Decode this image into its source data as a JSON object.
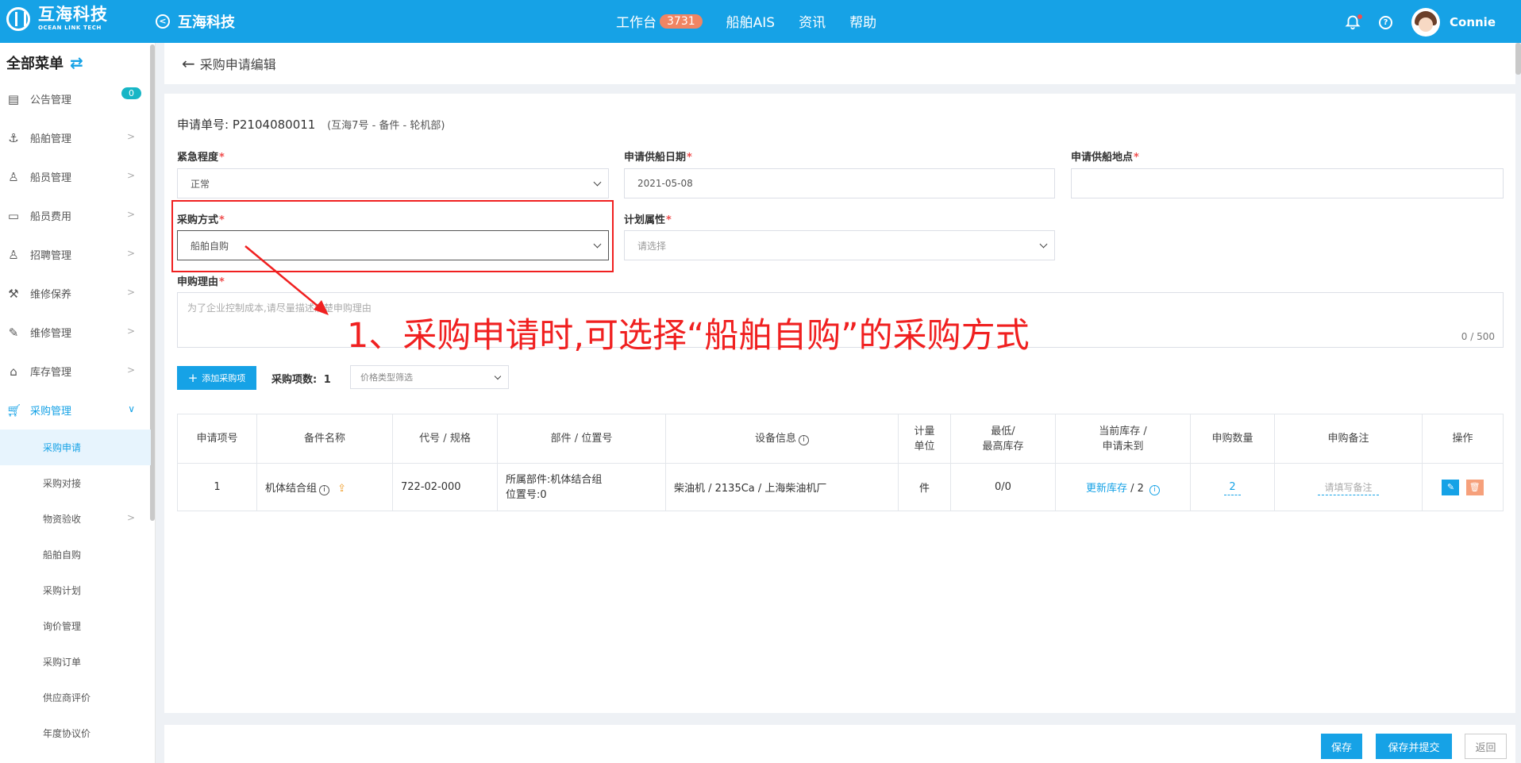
{
  "brand": {
    "cn": "互海科技",
    "en": "OCEAN LINK TECH",
    "app_name": "互海科技"
  },
  "topnav": {
    "workbench": "工作台",
    "workbench_count": "3731",
    "ais": "船舶AIS",
    "news": "资讯",
    "help": "帮助"
  },
  "user": {
    "name": "Connie"
  },
  "sidebar": {
    "title": "全部菜单",
    "items": [
      {
        "label": "公告管理",
        "badge": "0"
      },
      {
        "label": "船舶管理"
      },
      {
        "label": "船员管理"
      },
      {
        "label": "船员费用"
      },
      {
        "label": "招聘管理"
      },
      {
        "label": "维修保养"
      },
      {
        "label": "维修管理"
      },
      {
        "label": "库存管理"
      },
      {
        "label": "采购管理"
      }
    ],
    "sub_items": [
      "采购申请",
      "采购对接",
      "物资验收",
      "船舶自购",
      "采购计划",
      "询价管理",
      "采购订单",
      "供应商评价",
      "年度协议价"
    ]
  },
  "page": {
    "back_title": "采购申请编辑"
  },
  "form": {
    "order_label": "申请单号:",
    "order_no": "P2104080011",
    "order_info": "(互海7号 - 备件 - 轮机部)",
    "urgency": {
      "label": "紧急程度",
      "value": "正常"
    },
    "supply_date": {
      "label": "申请供船日期",
      "value": "2021-05-08"
    },
    "supply_place": {
      "label": "申请供船地点",
      "value": ""
    },
    "purchase_method": {
      "label": "采购方式",
      "value": "船舶自购"
    },
    "plan_attr": {
      "label": "计划属性",
      "placeholder": "请选择"
    },
    "reason": {
      "label": "申购理由",
      "placeholder": "为了企业控制成本,请尽量描述清楚申购理由",
      "counter": "0 / 500"
    },
    "annotation": "1、采购申请时,可选择“船舶自购”的采购方式"
  },
  "toolbar": {
    "add_button": "添加采购项",
    "count_label": "采购项数:",
    "count": "1",
    "filter_placeholder": "价格类型筛选"
  },
  "table": {
    "headers": [
      "申请项号",
      "备件名称",
      "代号 / 规格",
      "部件 / 位置号",
      "设备信息",
      "计量单位",
      "最低/最高库存",
      "当前库存 / 申请未到",
      "申购数量",
      "申购备注",
      "操作"
    ],
    "header_lines": {
      "unit_1": "计量",
      "unit_2": "单位",
      "stock_1": "最低/",
      "stock_2": "最高库存",
      "cur_1": "当前库存 /",
      "cur_2": "申请未到"
    },
    "rows": [
      {
        "no": "1",
        "name": "机体结合组",
        "code": "722-02-000",
        "part_line1": "所属部件:机体结合组",
        "part_line2": "位置号:0",
        "equipment": "柴油机 / 2135Ca / 上海柴油机厂",
        "unit": "件",
        "min_max": "0/0",
        "update_stock": "更新库存",
        "pending": "/ 2",
        "qty": "2",
        "remark_placeholder": "请填写备注"
      }
    ]
  },
  "footer": {
    "save": "保存",
    "save_submit": "保存并提交",
    "back": "返回"
  },
  "colors": {
    "primary": "#16a2e6",
    "annotation": "#f02020",
    "badge": "#f18563"
  }
}
